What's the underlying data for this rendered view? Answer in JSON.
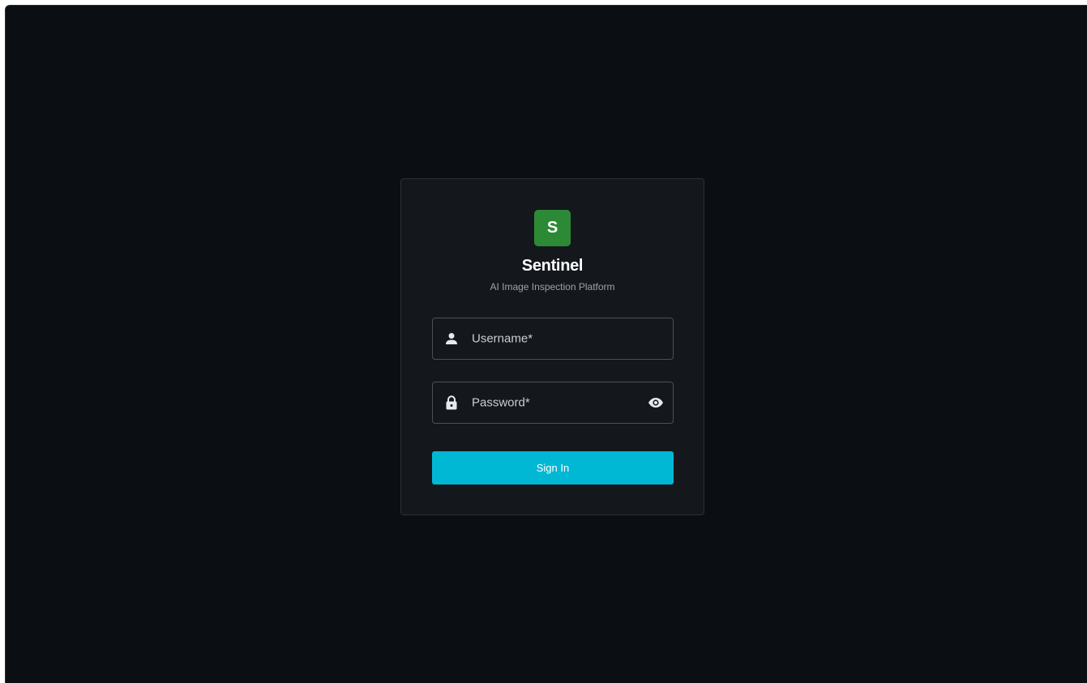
{
  "brand": {
    "logo_letter": "S",
    "title": "Sentinel",
    "subtitle": "AI Image Inspection Platform",
    "logo_color": "#2c8a36"
  },
  "form": {
    "username": {
      "label": "Username*",
      "value": "",
      "icon": "person-icon"
    },
    "password": {
      "label": "Password*",
      "value": "",
      "icon": "lock-icon",
      "toggle_icon": "eye-icon"
    },
    "submit_label": "Sign In",
    "submit_color": "#00b8d4"
  },
  "theme": {
    "background": "#0b0f13",
    "card": "#14181d"
  }
}
